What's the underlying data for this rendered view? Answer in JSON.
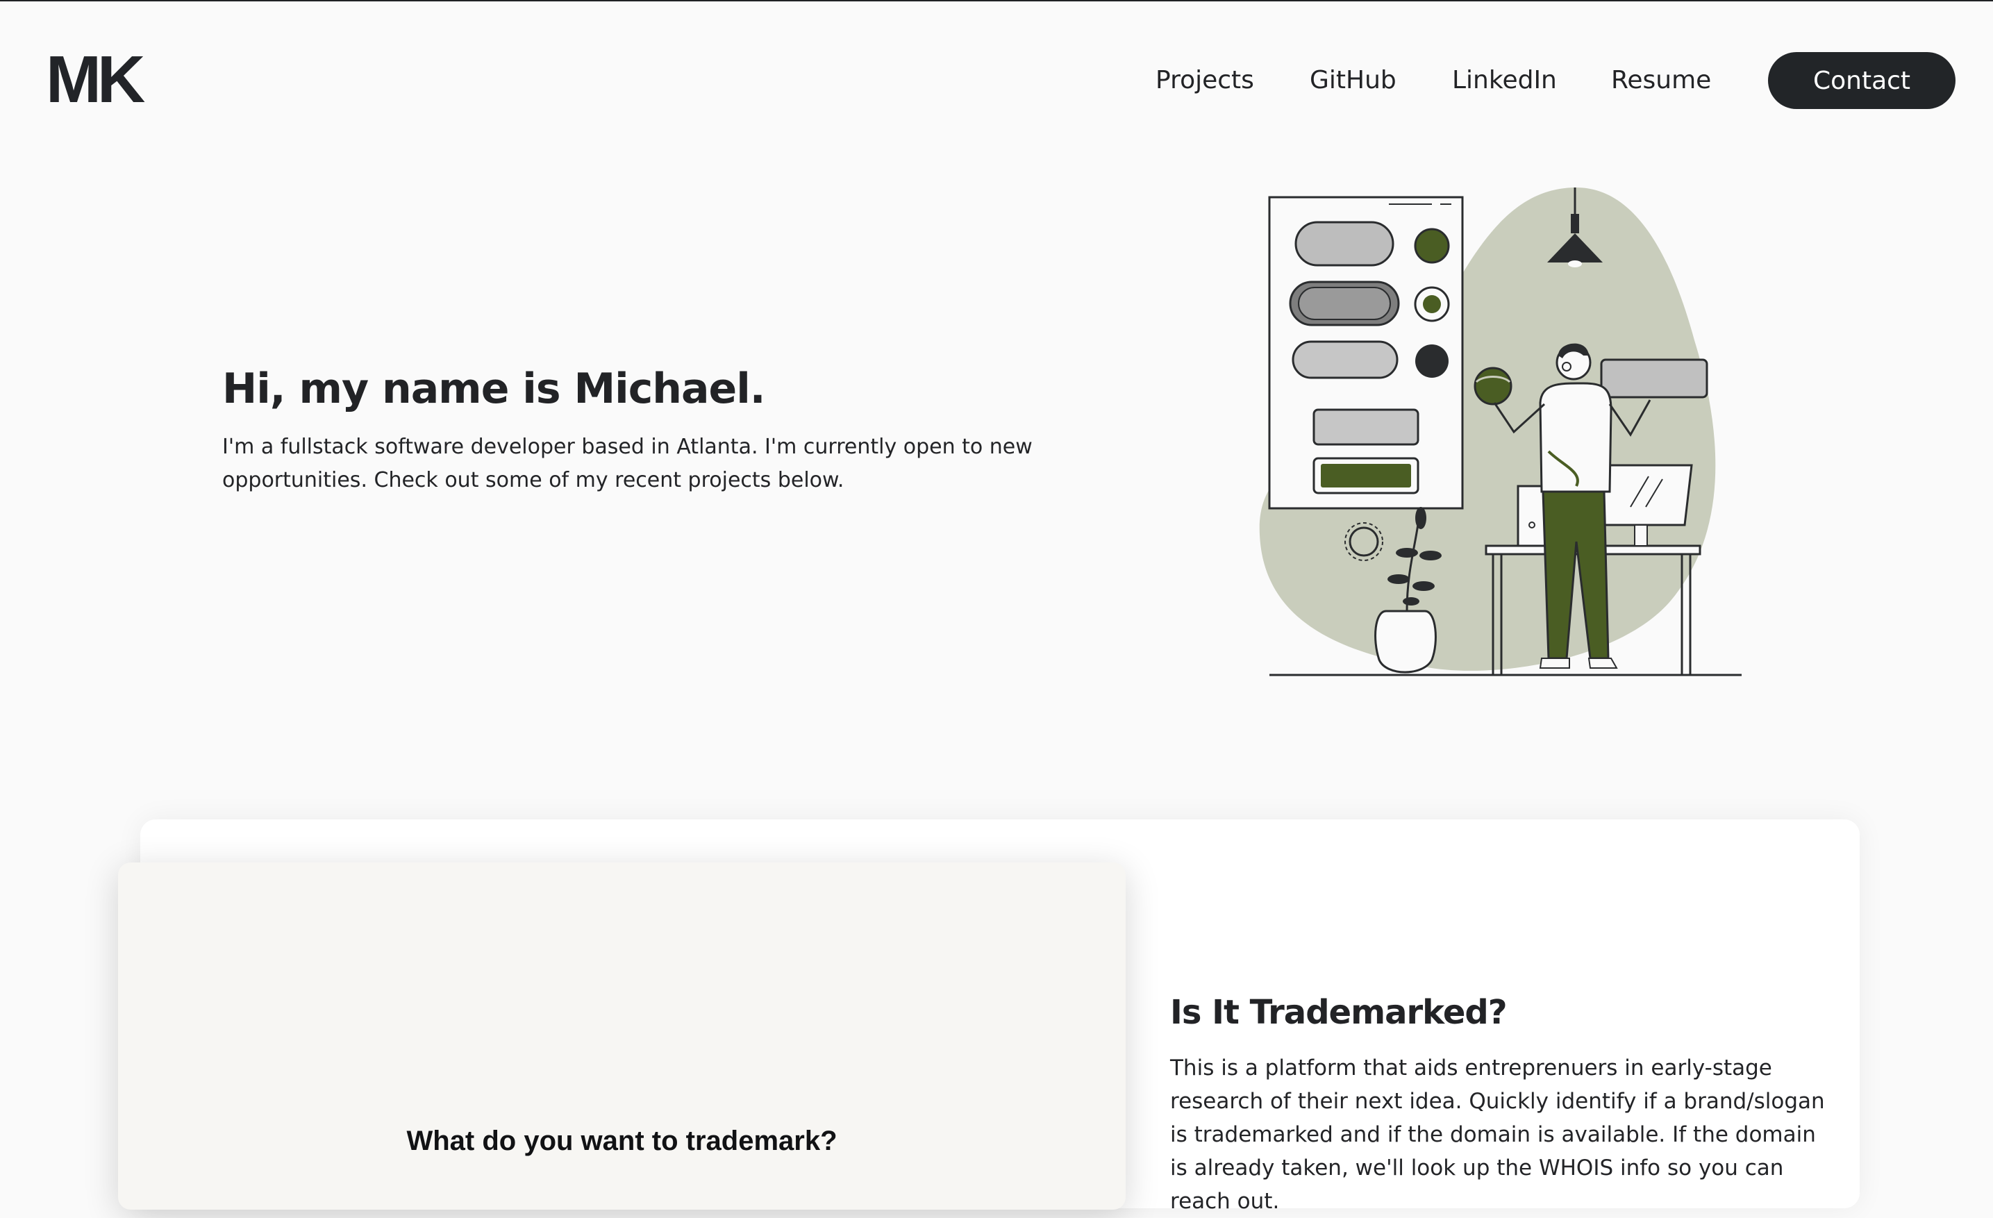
{
  "header": {
    "logo": "MK",
    "nav": {
      "projects": "Projects",
      "github": "GitHub",
      "linkedin": "LinkedIn",
      "resume": "Resume",
      "contact": "Contact"
    }
  },
  "hero": {
    "title": "Hi, my name is Michael.",
    "text": "I'm a fullstack software developer based in Atlanta. I'm currently open to new opportunities. Check out some of my recent projects below.",
    "illustration_icon": "developer-illustration"
  },
  "project": {
    "preview_heading": "What do you want to trademark?",
    "title": "Is It Trademarked?",
    "description": "This is a platform that aids entreprenuers in early-stage research of their next idea. Quickly identify if a brand/slogan is trademarked and if the domain is available. If the domain is already taken, we'll look up the WHOIS info so you can reach out."
  },
  "colors": {
    "background": "#fafafa",
    "text": "#222326",
    "button": "#222528",
    "accent_olive": "#4a5d23",
    "blob_sage": "#c9cdbc"
  }
}
